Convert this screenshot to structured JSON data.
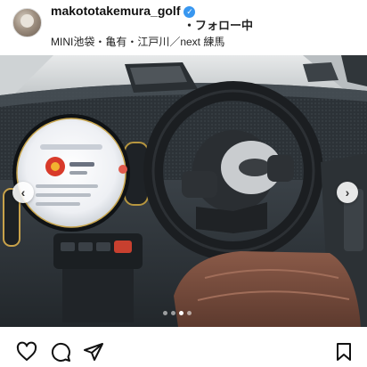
{
  "post": {
    "username": "makototakemura_golf",
    "follow_text": "・フォロー中",
    "subtitle": "MINI池袋・亀有・江戸川／next 練馬"
  },
  "photo": {
    "slide_count": 4,
    "active_slide": 3
  },
  "icons": {
    "verified": "verified-badge-icon",
    "like": "heart-icon",
    "comment": "comment-icon",
    "share": "send-icon",
    "save": "bookmark-icon",
    "prev": "chevron-left-icon",
    "next": "chevron-right-icon"
  }
}
